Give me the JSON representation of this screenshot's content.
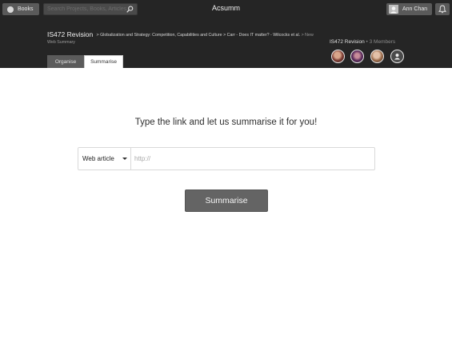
{
  "topbar": {
    "books_label": "Books",
    "search_placeholder": "Search Projects, Books, Articles...",
    "app_title": "Acsumm",
    "user_name": "Ann Chan"
  },
  "project": {
    "title": "IS472 Revision",
    "breadcrumbs": [
      "Globalization and Strategy: Competition, Capabilities and Culture",
      "Carr - Does IT matter? - Wilcocks et al."
    ],
    "current_crumb": "New Web Summary",
    "separator": ">"
  },
  "tabs": {
    "organise": "Organise",
    "summarise": "Summarise"
  },
  "group": {
    "name": "IS472 Revision",
    "bullet": "•",
    "members": "3 Members"
  },
  "main": {
    "headline": "Type the link and let us summarise it for you!",
    "source_type": "Web article",
    "url_placeholder": "http://",
    "submit_label": "Summarise"
  }
}
